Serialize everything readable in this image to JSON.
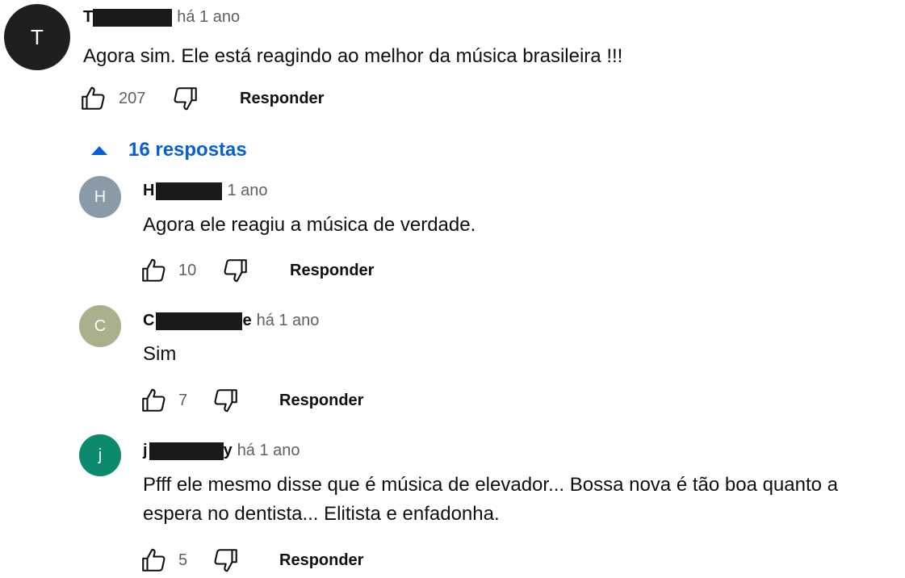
{
  "colors": {
    "avatar_top": "#1f1f1f",
    "avatar_h": "#8a9aa6",
    "avatar_c": "#a9b08c",
    "avatar_j": "#0b8a6e",
    "link": "#065fd4"
  },
  "top_comment": {
    "avatar_letter": "T",
    "author_visible_start": "T",
    "author_visible_end": "",
    "timestamp": "há 1 ano",
    "text": "Agora sim. Ele está reagindo ao melhor da música brasileira !!!",
    "likes": "207",
    "reply_label": "Responder",
    "like_icon": "thumbs-up-icon",
    "dislike_icon": "thumbs-down-icon"
  },
  "replies_toggle": {
    "label": "16 respostas",
    "icon": "caret-up-icon"
  },
  "replies": [
    {
      "avatar_letter": "H",
      "author_visible_start": "H",
      "author_visible_end": "",
      "timestamp": "1 ano",
      "text_lines": [
        "Agora ele reagiu a música de verdade."
      ],
      "likes": "10",
      "reply_label": "Responder"
    },
    {
      "avatar_letter": "C",
      "author_visible_start": "C",
      "author_visible_end": "e",
      "timestamp": "há 1 ano",
      "text_lines": [
        "Sim"
      ],
      "likes": "7",
      "reply_label": "Responder"
    },
    {
      "avatar_letter": "j",
      "author_visible_start": "j",
      "author_visible_end": "y",
      "timestamp": "há 1 ano",
      "text_lines": [
        "Pfff ele mesmo disse que é música de elevador... Bossa nova é tão boa quanto a",
        "espera no dentista... Elitista e enfadonha."
      ],
      "likes": "5",
      "reply_label": "Responder"
    }
  ]
}
